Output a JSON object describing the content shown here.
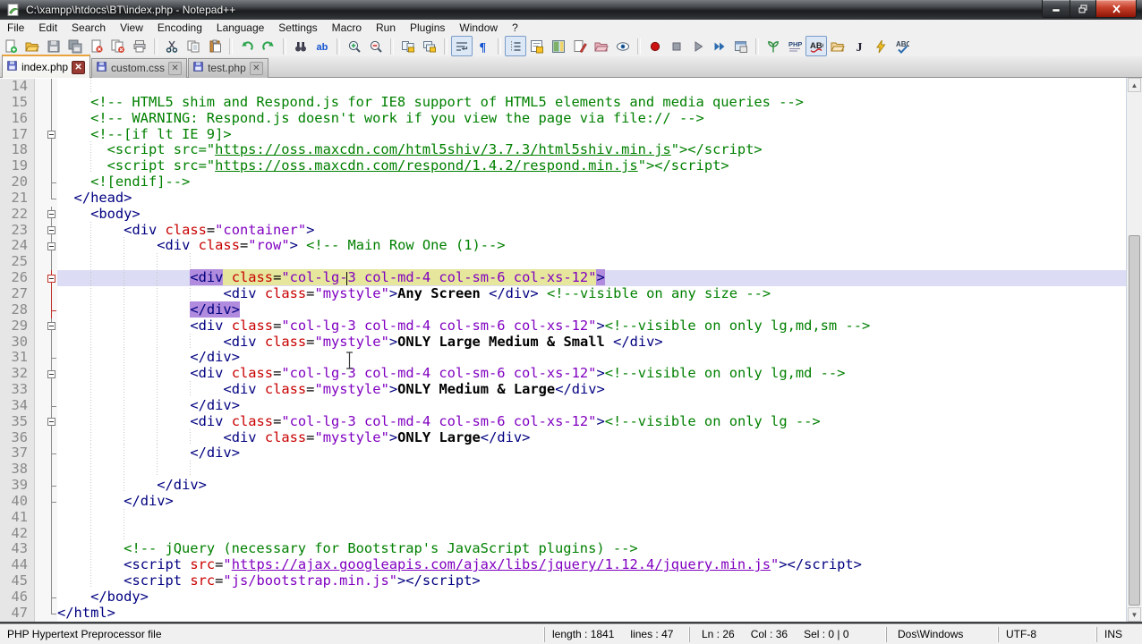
{
  "window": {
    "title": "C:\\xampp\\htdocs\\BT\\index.php - Notepad++"
  },
  "window_controls": {
    "minimize": "minimize",
    "restore": "restore",
    "close": "close"
  },
  "menu": {
    "items": [
      "File",
      "Edit",
      "Search",
      "View",
      "Encoding",
      "Language",
      "Settings",
      "Macro",
      "Run",
      "Plugins",
      "Window",
      "?"
    ]
  },
  "toolbar": {
    "groups": [
      [
        "new-file",
        "open-file",
        "save",
        "save-all",
        "close",
        "close-all",
        "print"
      ],
      [
        "cut",
        "copy",
        "paste"
      ],
      [
        "undo",
        "redo"
      ],
      [
        "find",
        "replace"
      ],
      [
        "zoom-in",
        "zoom-out"
      ],
      [
        "sync-scroll-v",
        "sync-scroll-h"
      ],
      [
        "word-wrap",
        "show-all-chars"
      ],
      [
        "indent-guide",
        "function-list",
        "doc-map",
        "doc-switcher",
        "folder-workspace",
        "file-monitoring"
      ],
      [
        "macro-record",
        "macro-stop",
        "macro-play",
        "macro-run-multiple",
        "macro-save"
      ],
      [
        "textfx",
        "php-help",
        "spell-check",
        "project-folder",
        "quote",
        "run-lightning",
        "abc-check"
      ]
    ],
    "pressed": [
      "word-wrap",
      "indent-guide",
      "spell-check"
    ]
  },
  "tabs": [
    {
      "label": "index.php",
      "active": true
    },
    {
      "label": "custom.css",
      "active": false
    },
    {
      "label": "test.php",
      "active": false
    }
  ],
  "editor": {
    "first_line": 14,
    "colors": {
      "tag": "#000080",
      "attribute": "#c80000",
      "value": "#8000c0",
      "comment": "#008000",
      "current_line_bg": "#dcdcf4",
      "tag_match_bg": "#b18bdd",
      "attr_highlight_bg": "#e6e69c"
    },
    "lines": [
      {
        "n": 14,
        "ind": 8,
        "f": "tb",
        "r": 0,
        "cur": 0,
        "blank": 1,
        "s": []
      },
      {
        "n": 15,
        "ind": 4,
        "f": "tb",
        "r": 0,
        "cur": 0,
        "blank": 0,
        "s": [
          [
            "c",
            "<!-- HTML5 shim and Respond.js for IE8 support of HTML5 elements and media queries -->"
          ]
        ]
      },
      {
        "n": 16,
        "ind": 4,
        "f": "tb",
        "r": 0,
        "cur": 0,
        "blank": 0,
        "s": [
          [
            "c",
            "<!-- WARNING: Respond.js doesn't work if you view the page via file:// -->"
          ]
        ]
      },
      {
        "n": 17,
        "ind": 4,
        "f": "tbx",
        "r": 0,
        "cur": 0,
        "blank": 0,
        "s": [
          [
            "c",
            "<!--[if lt IE 9]>"
          ]
        ]
      },
      {
        "n": 18,
        "ind": 6,
        "f": "tb",
        "r": 0,
        "cur": 0,
        "blank": 0,
        "s": [
          [
            "c",
            "<script src=\""
          ],
          [
            "cu",
            "https://oss.maxcdn.com/html5shiv/3.7.3/html5shiv.min.js"
          ],
          [
            "c",
            "\"></script>"
          ]
        ]
      },
      {
        "n": 19,
        "ind": 6,
        "f": "tb",
        "r": 0,
        "cur": 0,
        "blank": 0,
        "s": [
          [
            "c",
            "<script src=\""
          ],
          [
            "cu",
            "https://oss.maxcdn.com/respond/1.4.2/respond.min.js"
          ],
          [
            "c",
            "\"></script>"
          ]
        ]
      },
      {
        "n": 20,
        "ind": 4,
        "f": "tbk",
        "r": 0,
        "cur": 0,
        "blank": 0,
        "s": [
          [
            "c",
            "<![endif]-->"
          ]
        ]
      },
      {
        "n": 21,
        "ind": 2,
        "f": "tk",
        "r": 0,
        "cur": 0,
        "blank": 0,
        "s": [
          [
            "t",
            "</head>"
          ]
        ]
      },
      {
        "n": 22,
        "ind": 4,
        "f": "tbx",
        "r": 0,
        "cur": 0,
        "blank": 0,
        "s": [
          [
            "t",
            "<body>"
          ]
        ]
      },
      {
        "n": 23,
        "ind": 8,
        "f": "tbx",
        "r": 0,
        "cur": 0,
        "blank": 0,
        "s": [
          [
            "t",
            "<div"
          ],
          [
            "p",
            " "
          ],
          [
            "a",
            "class"
          ],
          [
            "p",
            "="
          ],
          [
            "v",
            "\"container\""
          ],
          [
            "t",
            ">"
          ]
        ]
      },
      {
        "n": 24,
        "ind": 12,
        "f": "tbx",
        "r": 0,
        "cur": 0,
        "blank": 0,
        "s": [
          [
            "t",
            "<div"
          ],
          [
            "p",
            " "
          ],
          [
            "a",
            "class"
          ],
          [
            "p",
            "="
          ],
          [
            "v",
            "\"row\""
          ],
          [
            "t",
            ">"
          ],
          [
            "p",
            " "
          ],
          [
            "c",
            "<!-- Main Row One (1)-->"
          ]
        ]
      },
      {
        "n": 25,
        "ind": 17,
        "f": "tb",
        "r": 0,
        "cur": 0,
        "blank": 1,
        "s": []
      },
      {
        "n": 26,
        "ind": 16,
        "f": "tbx",
        "r": 1,
        "cur": 1,
        "blank": 0,
        "s": [
          [
            "t hT",
            "<div"
          ],
          [
            "p hA",
            " "
          ],
          [
            "a hA",
            "class"
          ],
          [
            "p hA",
            "="
          ],
          [
            "v hA",
            "\"col-lg-"
          ],
          [
            "caret",
            ""
          ],
          [
            "v hA",
            "3 col-md-4 col-sm-6 col-xs-12\""
          ],
          [
            "t hT",
            ">"
          ]
        ]
      },
      {
        "n": 27,
        "ind": 20,
        "f": "tb",
        "r": 1,
        "cur": 0,
        "blank": 0,
        "s": [
          [
            "t",
            "<div"
          ],
          [
            "p",
            " "
          ],
          [
            "a",
            "class"
          ],
          [
            "p",
            "="
          ],
          [
            "v",
            "\"mystyle\""
          ],
          [
            "t",
            ">"
          ],
          [
            "b",
            "Any Screen "
          ],
          [
            "t",
            "</div>"
          ],
          [
            "p",
            " "
          ],
          [
            "c",
            "<!--visible on any size -->"
          ]
        ]
      },
      {
        "n": 28,
        "ind": 16,
        "f": "tbk",
        "r": 1,
        "cur": 0,
        "blank": 0,
        "s": [
          [
            "t hT",
            "</div>"
          ]
        ]
      },
      {
        "n": 29,
        "ind": 16,
        "f": "tbx",
        "r": 0,
        "cur": 0,
        "blank": 0,
        "s": [
          [
            "t",
            "<div"
          ],
          [
            "p",
            " "
          ],
          [
            "a",
            "class"
          ],
          [
            "p",
            "="
          ],
          [
            "v",
            "\"col-lg-3 col-md-4 col-sm-6 col-xs-12\""
          ],
          [
            "t",
            ">"
          ],
          [
            "c",
            "<!--visible on only lg,md,sm -->"
          ]
        ]
      },
      {
        "n": 30,
        "ind": 20,
        "f": "tb",
        "r": 0,
        "cur": 0,
        "blank": 0,
        "s": [
          [
            "t",
            "<div"
          ],
          [
            "p",
            " "
          ],
          [
            "a",
            "class"
          ],
          [
            "p",
            "="
          ],
          [
            "v",
            "\"mystyle\""
          ],
          [
            "t",
            ">"
          ],
          [
            "b",
            "ONLY Large Medium & Small "
          ],
          [
            "t",
            "</div>"
          ]
        ]
      },
      {
        "n": 31,
        "ind": 16,
        "f": "tbk",
        "r": 0,
        "cur": 0,
        "blank": 0,
        "s": [
          [
            "t",
            "</div>"
          ]
        ]
      },
      {
        "n": 32,
        "ind": 16,
        "f": "tbx",
        "r": 0,
        "cur": 0,
        "blank": 0,
        "s": [
          [
            "t",
            "<div"
          ],
          [
            "p",
            " "
          ],
          [
            "a",
            "class"
          ],
          [
            "p",
            "="
          ],
          [
            "v",
            "\"col-lg-3 col-md-4 col-sm-6 col-xs-12\""
          ],
          [
            "t",
            ">"
          ],
          [
            "c",
            "<!--visible on only lg,md -->"
          ]
        ]
      },
      {
        "n": 33,
        "ind": 20,
        "f": "tb",
        "r": 0,
        "cur": 0,
        "blank": 0,
        "s": [
          [
            "t",
            "<div"
          ],
          [
            "p",
            " "
          ],
          [
            "a",
            "class"
          ],
          [
            "p",
            "="
          ],
          [
            "v",
            "\"mystyle\""
          ],
          [
            "t",
            ">"
          ],
          [
            "b",
            "ONLY Medium & Large"
          ],
          [
            "t",
            "</div>"
          ]
        ]
      },
      {
        "n": 34,
        "ind": 16,
        "f": "tbk",
        "r": 0,
        "cur": 0,
        "blank": 0,
        "s": [
          [
            "t",
            "</div>"
          ]
        ]
      },
      {
        "n": 35,
        "ind": 16,
        "f": "tbx",
        "r": 0,
        "cur": 0,
        "blank": 0,
        "s": [
          [
            "t",
            "<div"
          ],
          [
            "p",
            " "
          ],
          [
            "a",
            "class"
          ],
          [
            "p",
            "="
          ],
          [
            "v",
            "\"col-lg-3 col-md-4 col-sm-6 col-xs-12\""
          ],
          [
            "t",
            ">"
          ],
          [
            "c",
            "<!--visible on only lg -->"
          ]
        ]
      },
      {
        "n": 36,
        "ind": 20,
        "f": "tb",
        "r": 0,
        "cur": 0,
        "blank": 0,
        "s": [
          [
            "t",
            "<div"
          ],
          [
            "p",
            " "
          ],
          [
            "a",
            "class"
          ],
          [
            "p",
            "="
          ],
          [
            "v",
            "\"mystyle\""
          ],
          [
            "t",
            ">"
          ],
          [
            "b",
            "ONLY Large"
          ],
          [
            "t",
            "</div>"
          ]
        ]
      },
      {
        "n": 37,
        "ind": 16,
        "f": "tbk",
        "r": 0,
        "cur": 0,
        "blank": 0,
        "s": [
          [
            "t",
            "</div>"
          ]
        ]
      },
      {
        "n": 38,
        "ind": 17,
        "f": "tb",
        "r": 0,
        "cur": 0,
        "blank": 1,
        "s": []
      },
      {
        "n": 39,
        "ind": 12,
        "f": "tbk",
        "r": 0,
        "cur": 0,
        "blank": 0,
        "s": [
          [
            "t",
            "</div>"
          ]
        ]
      },
      {
        "n": 40,
        "ind": 8,
        "f": "tbk",
        "r": 0,
        "cur": 0,
        "blank": 0,
        "s": [
          [
            "t",
            "</div>"
          ]
        ]
      },
      {
        "n": 41,
        "ind": 9,
        "f": "tb",
        "r": 0,
        "cur": 0,
        "blank": 1,
        "s": []
      },
      {
        "n": 42,
        "ind": 9,
        "f": "tb",
        "r": 0,
        "cur": 0,
        "blank": 1,
        "s": []
      },
      {
        "n": 43,
        "ind": 8,
        "f": "tb",
        "r": 0,
        "cur": 0,
        "blank": 0,
        "s": [
          [
            "c",
            "<!-- jQuery (necessary for Bootstrap's JavaScript plugins) -->"
          ]
        ]
      },
      {
        "n": 44,
        "ind": 8,
        "f": "tb",
        "r": 0,
        "cur": 0,
        "blank": 0,
        "s": [
          [
            "t",
            "<script"
          ],
          [
            "p",
            " "
          ],
          [
            "a",
            "src"
          ],
          [
            "p",
            "="
          ],
          [
            "v",
            "\""
          ],
          [
            "vu",
            "https://ajax.googleapis.com/ajax/libs/jquery/1.12.4/jquery.min.js"
          ],
          [
            "v",
            "\""
          ],
          [
            "t",
            "></script>"
          ]
        ]
      },
      {
        "n": 45,
        "ind": 8,
        "f": "tb",
        "r": 0,
        "cur": 0,
        "blank": 0,
        "s": [
          [
            "t",
            "<script"
          ],
          [
            "p",
            " "
          ],
          [
            "a",
            "src"
          ],
          [
            "p",
            "="
          ],
          [
            "v",
            "\"js/bootstrap.min.js\""
          ],
          [
            "t",
            "></script>"
          ]
        ]
      },
      {
        "n": 46,
        "ind": 4,
        "f": "tbk",
        "r": 0,
        "cur": 0,
        "blank": 0,
        "s": [
          [
            "t",
            "</body>"
          ]
        ]
      },
      {
        "n": 47,
        "ind": 0,
        "f": "tk",
        "r": 0,
        "cur": 0,
        "blank": 0,
        "s": [
          [
            "t",
            "</html>"
          ]
        ]
      }
    ]
  },
  "status": {
    "doc_type": "PHP Hypertext Preprocessor file",
    "length_label": "length : 1841",
    "lines_label": "lines : 47",
    "ln": "Ln : 26",
    "col": "Col : 36",
    "sel": "Sel : 0 | 0",
    "eol": "Dos\\Windows",
    "encoding": "UTF-8",
    "mode": "INS"
  }
}
